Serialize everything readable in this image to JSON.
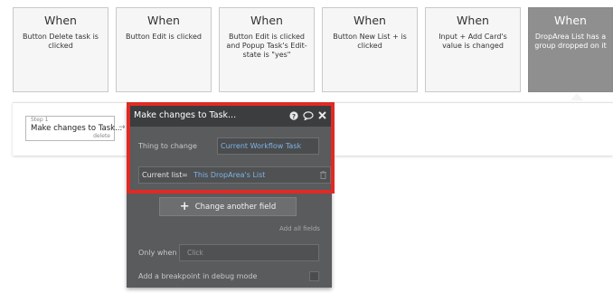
{
  "events": [
    {
      "title": "When",
      "description": "Button Delete task is clicked",
      "active": false
    },
    {
      "title": "When",
      "description": "Button Edit is clicked",
      "active": false
    },
    {
      "title": "When",
      "description": "Button Edit is clicked and Popup Task's Edit-state is \"yes\"",
      "active": false
    },
    {
      "title": "When",
      "description": "Button New List + is clicked",
      "active": false
    },
    {
      "title": "When",
      "description": "Input + Add Card's value is changed",
      "active": false
    },
    {
      "title": "When",
      "description": "DropArea List has a group dropped on it",
      "active": true
    }
  ],
  "step": {
    "label": "Step 1",
    "name": "Make changes to Task...",
    "delete_label": "delete",
    "add_arrow": "→"
  },
  "panel": {
    "title": "Make changes to Task...",
    "icons": {
      "help": "help-icon",
      "comment": "comment-icon",
      "close": "close-icon"
    },
    "thing_label": "Thing to change",
    "thing_value": "Current Workflow Task",
    "current_list_label": "Current list",
    "current_list_operator": "=",
    "current_list_value": "This DropArea's List",
    "change_another_label": "Change another field",
    "add_all_fields": "Add all fields",
    "only_when_label": "Only when",
    "only_when_placeholder": "Click",
    "debug_label": "Add a breakpoint in debug mode"
  },
  "colors": {
    "highlight_frame": "#e02a24",
    "dynamic_value": "#7fb3e6",
    "panel_bg": "#595b5d",
    "active_event": "#8f8f8f"
  }
}
